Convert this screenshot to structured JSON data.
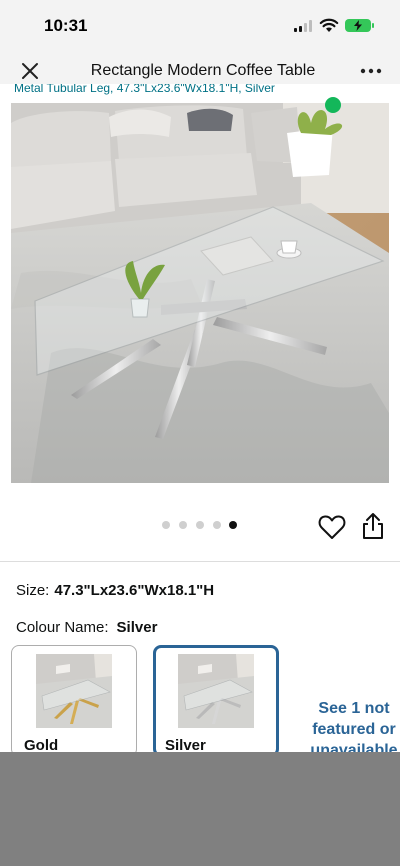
{
  "status_bar": {
    "time": "10:31",
    "icons": [
      "signal-icon",
      "wifi-icon",
      "battery-charging-icon"
    ]
  },
  "header": {
    "title": "Rectangle Modern Coffee Table",
    "close_icon": "close-icon",
    "more_icon": "more-horizontal-icon"
  },
  "product": {
    "subtitle_fragment": "Metal Tubular Leg, 47.3\"Lx23.6\"Wx18.1\"H, Silver",
    "image_count": 5,
    "active_image_index": 4
  },
  "actions": {
    "wishlist_icon": "heart-outline-icon",
    "share_icon": "share-icon"
  },
  "size": {
    "label": "Size:",
    "value": "47.3\"Lx23.6\"Wx18.1\"H"
  },
  "colour": {
    "label": "Colour Name:",
    "value": "Silver",
    "options": [
      {
        "name": "Gold",
        "selected": false
      },
      {
        "name": "Silver",
        "selected": true
      }
    ],
    "see_more": "See 1 not featured or unavailable"
  },
  "colors": {
    "link": "#007185",
    "selected_border": "#2a6496",
    "status_green": "#34c759",
    "overlay": "#808080"
  }
}
